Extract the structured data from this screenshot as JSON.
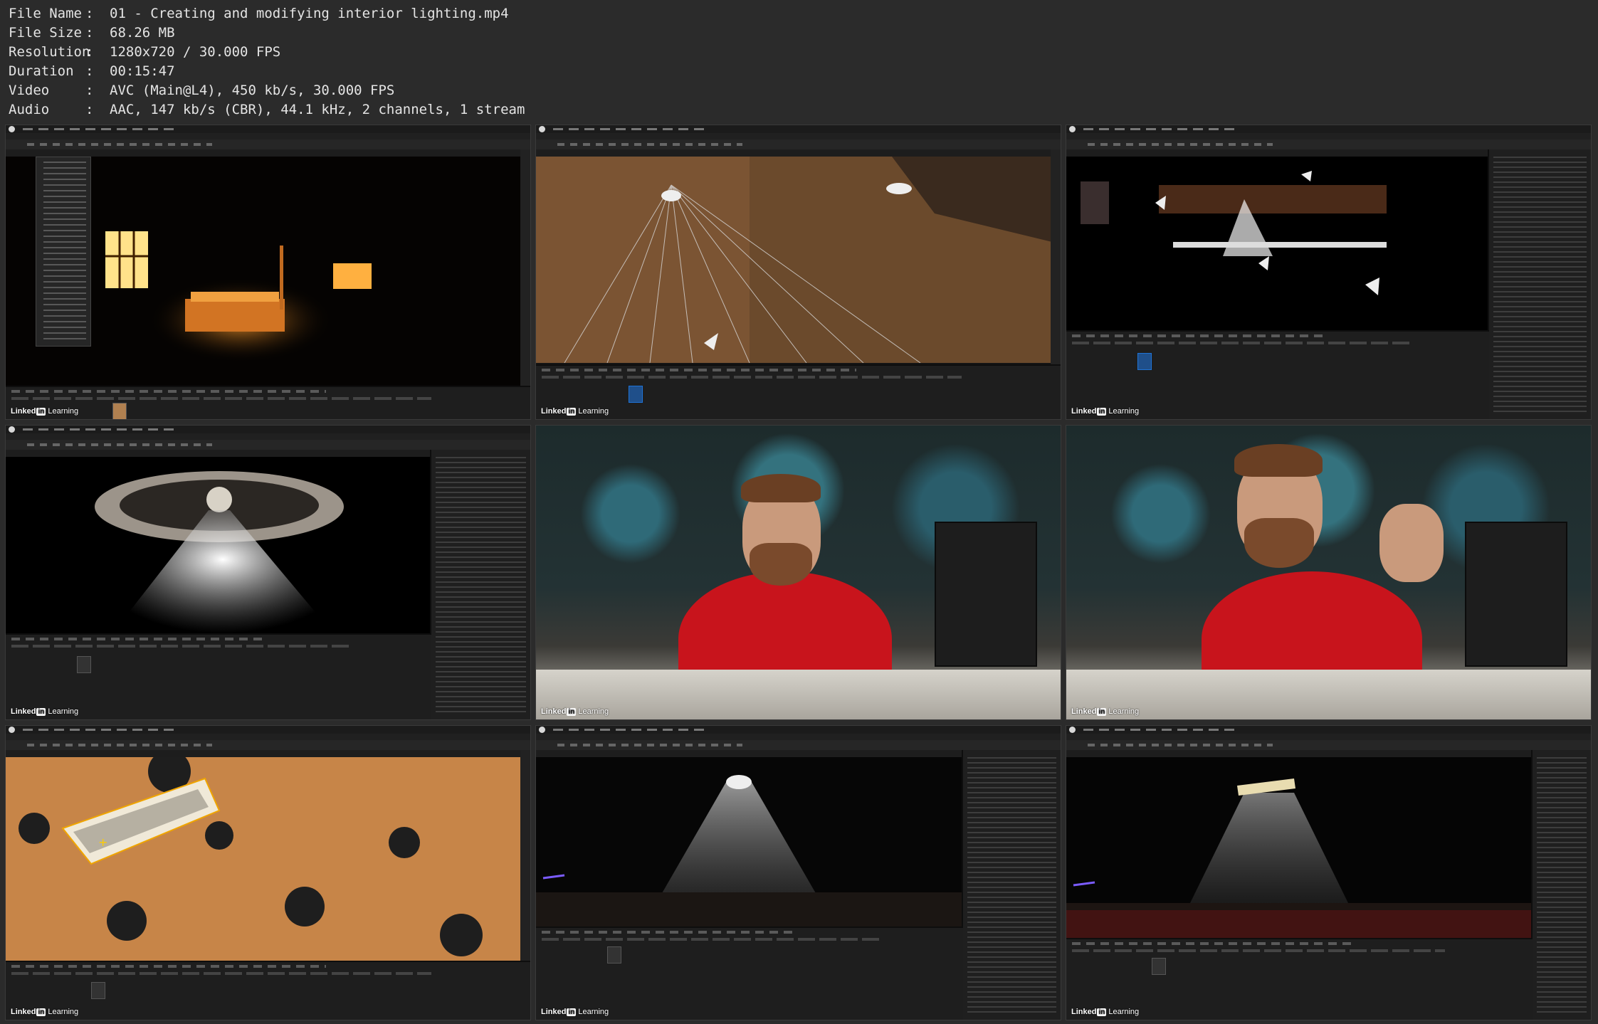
{
  "file_info": [
    {
      "key": "File Name",
      "sep": ":",
      "value": "01 - Creating and modifying interior lighting.mp4"
    },
    {
      "key": "File Size",
      "sep": ":",
      "value": "68.26 MB"
    },
    {
      "key": "Resolution",
      "sep": ":",
      "value": "1280x720 / 30.000 FPS"
    },
    {
      "key": "Duration",
      "sep": ":",
      "value": "00:15:47"
    },
    {
      "key": "Video",
      "sep": ":",
      "value": "AVC (Main@L4), 450 kb/s, 30.000 FPS"
    },
    {
      "key": "Audio",
      "sep": ":",
      "value": "AAC, 147 kb/s (CBR), 44.1 kHz, 2 channels, 1 stream"
    }
  ],
  "watermark": {
    "brand": "Linked",
    "in": "in",
    "suffix": "Learning"
  },
  "colors": {
    "accent": "#1f73d6",
    "shirt": "#c8141c",
    "background": "#2b2b2b"
  },
  "frames": [
    {
      "scene": "editor-dark-room-dropdown"
    },
    {
      "scene": "editor-ceiling-light-rays"
    },
    {
      "scene": "editor-dark-room-lamps"
    },
    {
      "scene": "editor-lamp-closeup"
    },
    {
      "scene": "presenter-talking"
    },
    {
      "scene": "presenter-gesturing"
    },
    {
      "scene": "editor-ceiling-fixture"
    },
    {
      "scene": "editor-spotlight-cone"
    },
    {
      "scene": "editor-fixture-glow"
    }
  ]
}
